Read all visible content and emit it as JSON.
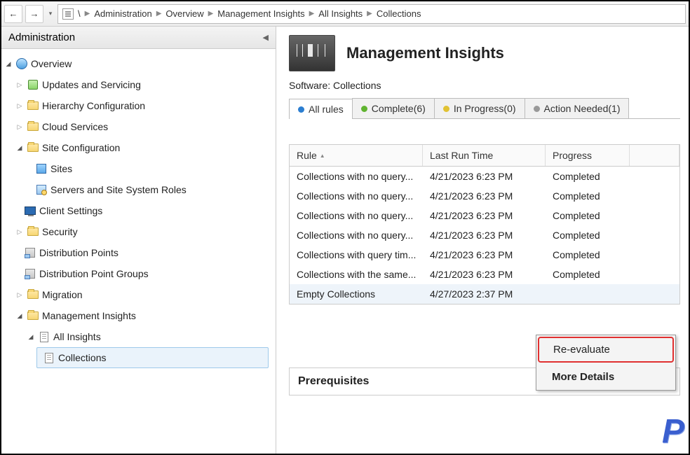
{
  "breadcrumb": {
    "items": [
      "\\",
      "Administration",
      "Overview",
      "Management Insights",
      "All Insights",
      "Collections"
    ]
  },
  "sidebar": {
    "title": "Administration",
    "nodes": {
      "overview": "Overview",
      "updates": "Updates and Servicing",
      "hierarchy": "Hierarchy Configuration",
      "cloud": "Cloud Services",
      "siteconf": "Site Configuration",
      "sites": "Sites",
      "servers": "Servers and Site System Roles",
      "client": "Client Settings",
      "security": "Security",
      "dp": "Distribution Points",
      "dpg": "Distribution Point Groups",
      "migration": "Migration",
      "mi": "Management Insights",
      "alli": "All Insights",
      "coll": "Collections"
    }
  },
  "header": {
    "title": "Management Insights",
    "software_label": "Software:",
    "software_value": "Collections"
  },
  "tabs": {
    "all": "All rules",
    "complete": "Complete(6)",
    "inprog": "In Progress(0)",
    "action": "Action Needed(1)"
  },
  "columns": {
    "rule": "Rule",
    "time": "Last Run Time",
    "progress": "Progress"
  },
  "rows": [
    {
      "rule": "Collections with no query...",
      "time": "4/21/2023 6:23 PM",
      "progress": "Completed"
    },
    {
      "rule": "Collections with no query...",
      "time": "4/21/2023 6:23 PM",
      "progress": "Completed"
    },
    {
      "rule": "Collections with no query...",
      "time": "4/21/2023 6:23 PM",
      "progress": "Completed"
    },
    {
      "rule": "Collections with no query...",
      "time": "4/21/2023 6:23 PM",
      "progress": "Completed"
    },
    {
      "rule": "Collections with query tim...",
      "time": "4/21/2023 6:23 PM",
      "progress": "Completed"
    },
    {
      "rule": "Collections with the same...",
      "time": "4/21/2023 6:23 PM",
      "progress": "Completed"
    },
    {
      "rule": "Empty Collections",
      "time": "4/27/2023 2:37 PM",
      "progress": ""
    }
  ],
  "context_menu": {
    "reeval": "Re-evaluate",
    "more": "More Details"
  },
  "prereq": {
    "title": "Prerequisites"
  },
  "logo": "P"
}
